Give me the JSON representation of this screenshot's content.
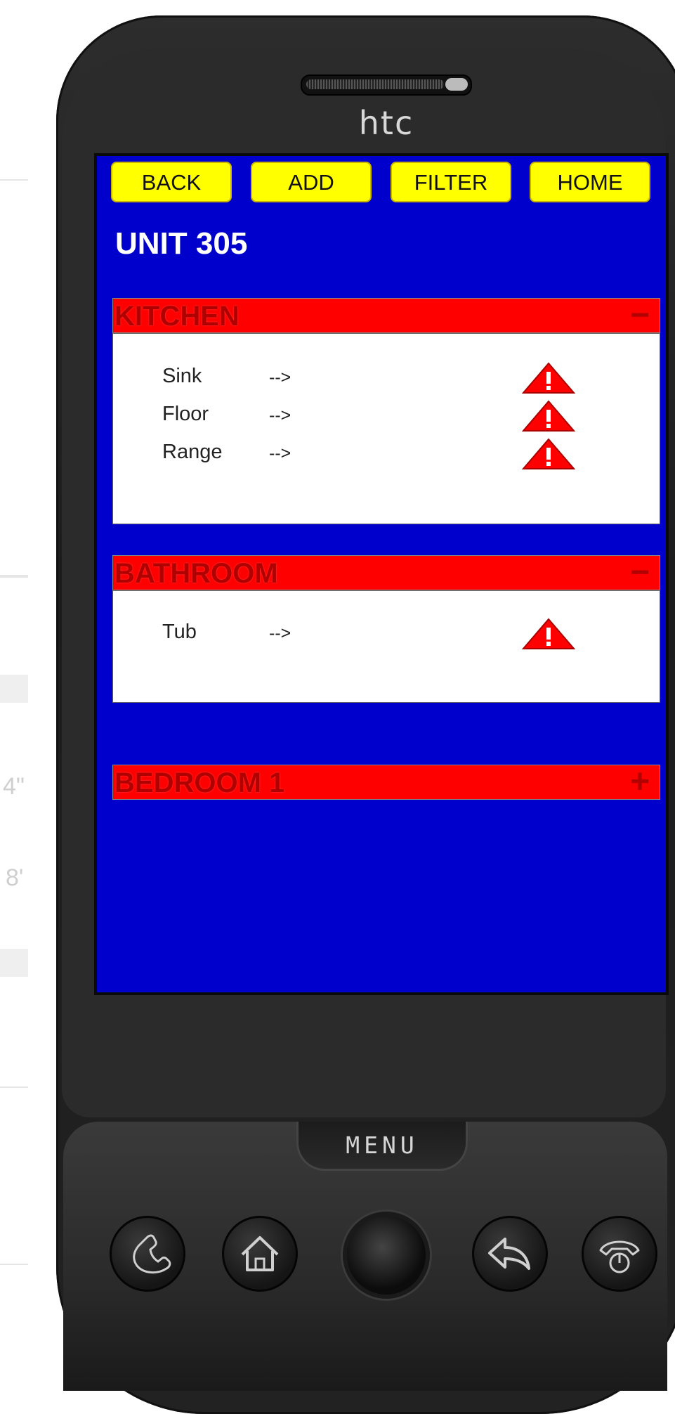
{
  "device": {
    "brand": "htc",
    "menu_label": "MENU"
  },
  "toolbar": {
    "back": "BACK",
    "add": "ADD",
    "filter": "FILTER",
    "home": "HOME"
  },
  "unit_title": "UNIT 305",
  "sections": [
    {
      "title": "KITCHEN",
      "toggle": "−",
      "expanded": true,
      "items": [
        {
          "name": "Sink",
          "arrow": "-->",
          "icon": "warning-icon"
        },
        {
          "name": "Floor",
          "arrow": "-->",
          "icon": "warning-icon"
        },
        {
          "name": "Range",
          "arrow": "-->",
          "icon": "warning-icon"
        }
      ]
    },
    {
      "title": "BATHROOM",
      "toggle": "−",
      "expanded": true,
      "items": [
        {
          "name": "Tub",
          "arrow": "-->",
          "icon": "warning-icon"
        }
      ]
    },
    {
      "title": "BEDROOM 1",
      "toggle": "+",
      "expanded": false,
      "items": []
    }
  ],
  "background_sketch": {
    "label_a": "4\"",
    "label_b": "8'"
  },
  "colors": {
    "screen_bg": "#0000cc",
    "button_bg": "#ffff00",
    "section_header": "#ff0000",
    "warning": "#ff0000"
  }
}
